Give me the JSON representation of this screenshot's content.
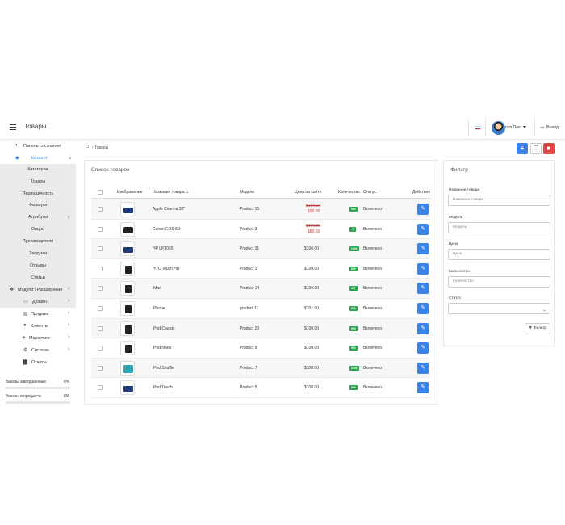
{
  "header": {
    "page_title": "Товары",
    "user_name": "ohn Doe",
    "logout_label": "Выход"
  },
  "breadcrumb": {
    "current": "Товары"
  },
  "sidebar": {
    "dashboard": "Панель состояния",
    "catalog": "Каталог",
    "catalog_items": [
      "Категории",
      "Товары",
      "Периодичность",
      "Фильтры",
      "Атрибуты",
      "Опции",
      "Производители",
      "Загрузки",
      "Отзывы",
      "Статьи"
    ],
    "sections": [
      "Модули / Расширения",
      "Дизайн",
      "Продажи",
      "Клиенты",
      "Маркетинг",
      "Система",
      "Отчеты"
    ],
    "stats": [
      {
        "label": "Заказы завершенные",
        "value": "0%"
      },
      {
        "label": "Заказы в процессе",
        "value": "0%"
      }
    ]
  },
  "products_panel": {
    "title": "Список товаров",
    "columns": {
      "image": "Изображение",
      "name": "Название товара",
      "model": "Модель",
      "price": "Цена на сайте",
      "quantity": "Количество",
      "status": "Статус",
      "actions": "Действия"
    },
    "rows": [
      {
        "name": "Apple Cinema 30\"",
        "model": "Product 15",
        "price": "$100.00",
        "special": "$90.00",
        "qty": "990",
        "status": "Включено",
        "thumb": "monitor"
      },
      {
        "name": "Canon EOS 5D",
        "model": "Product 3",
        "price": "$100.00",
        "special": "$80.00",
        "qty": "7",
        "status": "Включено",
        "thumb": "camera"
      },
      {
        "name": "HP LP3065",
        "model": "Product 21",
        "price": "$100.00",
        "special": "",
        "qty": "1000",
        "status": "Включено",
        "thumb": "monitor"
      },
      {
        "name": "HTC Touch HD",
        "model": "Product 1",
        "price": "$100.00",
        "special": "",
        "qty": "939",
        "status": "Включено",
        "thumb": "phone"
      },
      {
        "name": "iMac",
        "model": "Product 14",
        "price": "$100.00",
        "special": "",
        "qty": "977",
        "status": "Включено",
        "thumb": "phone"
      },
      {
        "name": "iPhone",
        "model": "product 11",
        "price": "$101.00",
        "special": "",
        "qty": "970",
        "status": "Включено",
        "thumb": "phone"
      },
      {
        "name": "iPod Classic",
        "model": "Product 20",
        "price": "$100.00",
        "special": "",
        "qty": "995",
        "status": "Включено",
        "thumb": "phone"
      },
      {
        "name": "iPod Nano",
        "model": "Product 9",
        "price": "$100.00",
        "special": "",
        "qty": "994",
        "status": "Включено",
        "thumb": "phone"
      },
      {
        "name": "iPod Shuffle",
        "model": "Product 7",
        "price": "$100.00",
        "special": "",
        "qty": "1000",
        "status": "Включено",
        "thumb": "square"
      },
      {
        "name": "iPod Touch",
        "model": "Product 5",
        "price": "$100.00",
        "special": "",
        "qty": "999",
        "status": "Включено",
        "thumb": "wide"
      }
    ]
  },
  "filter_panel": {
    "title": "Фильтр",
    "name_label": "Название товара",
    "name_placeholder": "Название товара",
    "model_label": "Модель",
    "model_placeholder": "Модель",
    "price_label": "Цена",
    "price_placeholder": "Цена",
    "qty_label": "Количество",
    "qty_placeholder": "Количество",
    "status_label": "Статус",
    "status_value": "",
    "button_label": "Фильтр"
  },
  "colors": {
    "accent": "#3a84e8",
    "danger": "#e04848",
    "success": "#2aa44f",
    "sidebar_active": "#ebebeb"
  },
  "icons": [
    "menu-icon",
    "home-icon",
    "plus-icon",
    "copy-icon",
    "trash-icon",
    "pencil-icon",
    "filter-icon",
    "logout-icon",
    "dashboard-icon",
    "tag-icon",
    "puzzle-icon",
    "monitor-icon",
    "cart-icon",
    "user-icon",
    "share-icon",
    "gear-icon",
    "chart-icon"
  ]
}
